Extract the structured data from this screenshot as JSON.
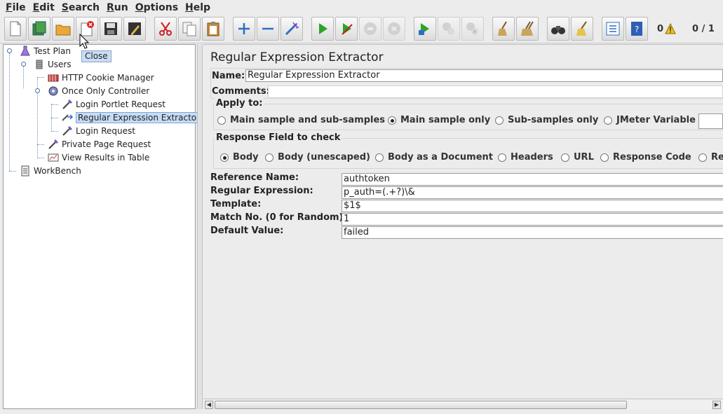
{
  "menubar": {
    "items": [
      {
        "first": "F",
        "rest": "ile"
      },
      {
        "first": "E",
        "rest": "dit"
      },
      {
        "first": "S",
        "rest": "earch"
      },
      {
        "first": "R",
        "rest": "un"
      },
      {
        "first": "O",
        "rest": "ptions"
      },
      {
        "first": "H",
        "rest": "elp"
      }
    ]
  },
  "toolbar": {
    "warnings_count": "0",
    "threads_status": "0 / 1"
  },
  "tooltip": {
    "text": "Close"
  },
  "tree": {
    "test_plan": "Test Plan",
    "users": "Users",
    "cookie_manager": "HTTP Cookie Manager",
    "once_only_controller": "Once Only Controller",
    "login_portlet_request": "Login Portlet Request",
    "regex_extractor": "Regular Expression Extractor",
    "login_request": "Login Request",
    "private_page_request": "Private Page Request",
    "view_results": "View Results in Table",
    "workbench": "WorkBench"
  },
  "panel": {
    "title": "Regular Expression Extractor",
    "name_label": "Name:",
    "name_value": "Regular Expression Extractor",
    "comments_label": "Comments:",
    "comments_value": "",
    "apply_to": {
      "label": "Apply to:",
      "options": [
        "Main sample and sub-samples",
        "Main sample only",
        "Sub-samples only",
        "JMeter Variable"
      ],
      "selected": "Main sample only"
    },
    "response_field": {
      "label": "Response Field to check",
      "options": [
        "Body",
        "Body (unescaped)",
        "Body as a Document",
        "Headers",
        "URL",
        "Response Code",
        "Re"
      ],
      "selected": "Body"
    },
    "reference_name_label": "Reference Name:",
    "reference_name_value": "authtoken",
    "regex_label": "Regular Expression:",
    "regex_value": "p_auth=(.+?)\\&",
    "template_label": "Template:",
    "template_value": "$1$",
    "match_no_label": "Match No. (0 for Random):",
    "match_no_value": "1",
    "default_label": "Default Value:",
    "default_value": "failed"
  },
  "colors": {
    "selection_bg": "#c7dcf5",
    "tooltip_bg": "#c9ddf5",
    "run_green": "#2aa52a",
    "add_blue": "#2d6fc4"
  }
}
